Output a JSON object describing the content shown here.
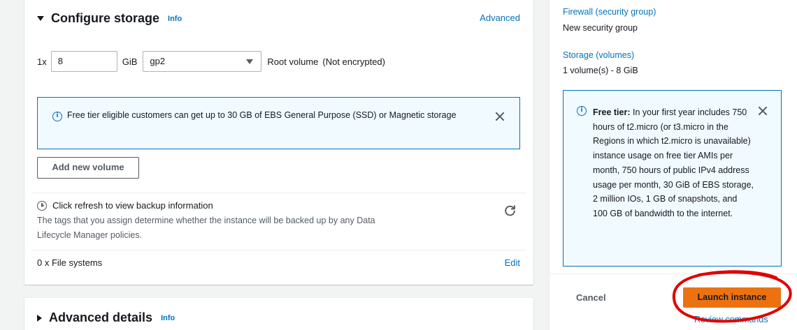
{
  "storage": {
    "title": "Configure storage",
    "info": "Info",
    "advanced_link": "Advanced",
    "volume": {
      "count_label": "1x",
      "size_value": "8",
      "unit": "GiB",
      "type_selected": "gp2",
      "root_label": "Root volume",
      "encryption": "(Not encrypted)"
    },
    "free_tier_alert": "Free tier eligible customers can get up to 30 GB of EBS General Purpose (SSD) or Magnetic storage",
    "add_volume_button": "Add new volume",
    "backup": {
      "title": "Click refresh to view backup information",
      "description": "The tags that you assign determine whether the instance will be backed up by any Data Lifecycle Manager policies."
    },
    "file_systems": "0 x File systems",
    "edit_link": "Edit"
  },
  "advanced_details": {
    "title": "Advanced details",
    "info": "Info"
  },
  "summary": {
    "firewall_label": "Firewall (security group)",
    "firewall_value": "New security group",
    "storage_label": "Storage (volumes)",
    "storage_value": "1 volume(s) - 8 GiB",
    "free_tier_bold": "Free tier:",
    "free_tier_text": " In your first year includes 750 hours of t2.micro (or t3.micro in the Regions in which t2.micro is unavailable) instance usage on free tier AMIs per month, 750 hours of public IPv4 address usage per month, 30 GiB of EBS storage, 2 million IOs, 1 GB of snapshots, and 100 GB of bandwidth to the internet.",
    "cancel": "Cancel",
    "launch": "Launch instance",
    "review": "Review commands"
  },
  "colors": {
    "link": "#0073bb",
    "primary_button": "#ec7211",
    "annotation": "#e00000"
  }
}
